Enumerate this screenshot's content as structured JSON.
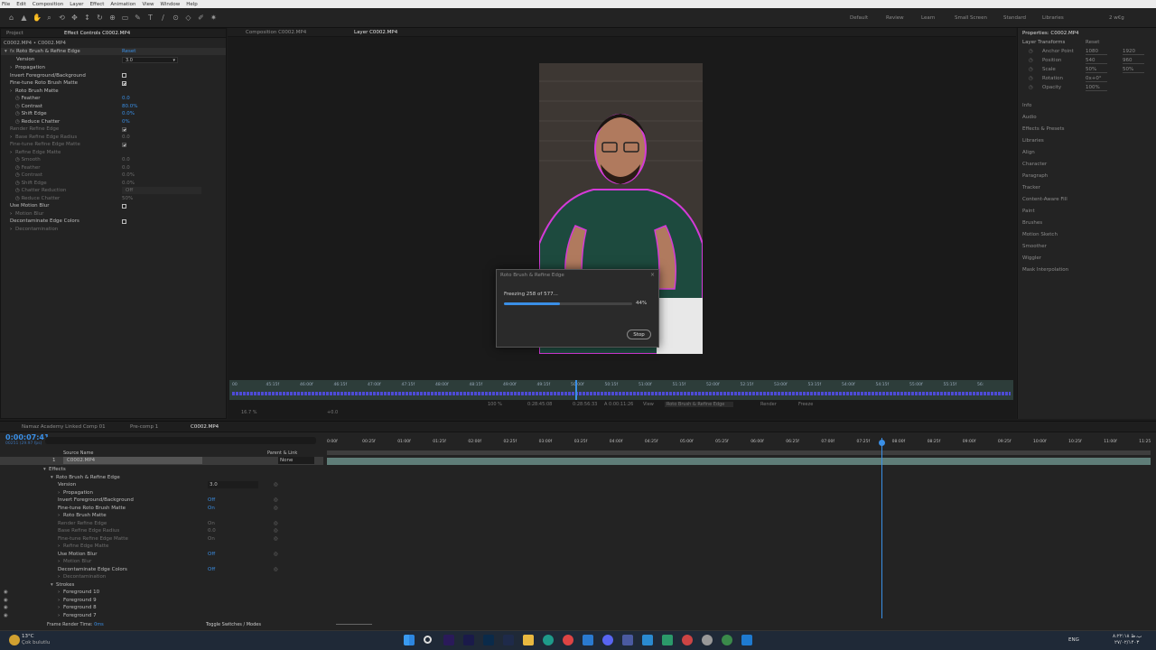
{
  "menu": [
    "File",
    "Edit",
    "Composition",
    "Layer",
    "Effect",
    "Animation",
    "View",
    "Window",
    "Help"
  ],
  "workspaces": [
    "Default",
    "Review",
    "Learn",
    "Small Screen",
    "Standard",
    "Libraries"
  ],
  "workspace_right": "2 w€g",
  "effect_controls": {
    "tabs": [
      "Project",
      "Effect Controls C0002.MP4"
    ],
    "header": "C0002.MP4 • C0002.MP4",
    "effect_name": "Roto Brush & Refine Edge",
    "reset": "Reset",
    "version_label": "Version",
    "version_value": "3.0",
    "rows": [
      {
        "label": "Propagation",
        "indent": 1,
        "twirl": true,
        "dim": false
      },
      {
        "label": "Invert Foreground/Background",
        "indent": 1,
        "dim": false,
        "checkbox": "off"
      },
      {
        "label": "Fine-tune Roto Brush Matte",
        "indent": 1,
        "dim": false,
        "checkbox": "on"
      },
      {
        "label": "Roto Brush Matte",
        "indent": 1,
        "twirl": true,
        "dim": false
      },
      {
        "label": "Feather",
        "indent": 2,
        "dim": false,
        "value": "0.0",
        "blue": true
      },
      {
        "label": "Contrast",
        "indent": 2,
        "dim": false,
        "value": "80.0%",
        "blue": true
      },
      {
        "label": "Shift Edge",
        "indent": 2,
        "dim": false,
        "value": "0.0%",
        "blue": true
      },
      {
        "label": "Reduce Chatter",
        "indent": 2,
        "dim": false,
        "value": "0%",
        "blue": true
      },
      {
        "label": "Render Refine Edge",
        "indent": 1,
        "dim": true,
        "checkbox": "on"
      },
      {
        "label": "Base Refine Edge Radius",
        "indent": 1,
        "twirl": true,
        "dim": true,
        "value": "0.0"
      },
      {
        "label": "Fine-tune Refine Edge Matte",
        "indent": 1,
        "dim": true,
        "checkbox": "on"
      },
      {
        "label": "Refine Edge Matte",
        "indent": 1,
        "twirl": true,
        "dim": true
      },
      {
        "label": "Smooth",
        "indent": 2,
        "dim": true,
        "value": "0.0"
      },
      {
        "label": "Feather",
        "indent": 2,
        "dim": true,
        "value": "0.0"
      },
      {
        "label": "Contrast",
        "indent": 2,
        "dim": true,
        "value": "0.0%"
      },
      {
        "label": "Shift Edge",
        "indent": 2,
        "dim": true,
        "value": "0.0%"
      },
      {
        "label": "Chatter Reduction",
        "indent": 2,
        "dim": true,
        "value": "Off"
      },
      {
        "label": "Reduce Chatter",
        "indent": 2,
        "dim": true,
        "value": "50%"
      },
      {
        "label": "Use Motion Blur",
        "indent": 1,
        "dim": false,
        "checkbox": "off"
      },
      {
        "label": "Motion Blur",
        "indent": 1,
        "twirl": true,
        "dim": true
      },
      {
        "label": "Decontaminate Edge Colors",
        "indent": 1,
        "dim": false,
        "checkbox": "off"
      },
      {
        "label": "Decontamination",
        "indent": 1,
        "twirl": true,
        "dim": true
      }
    ]
  },
  "viewer": {
    "tabs": [
      "Composition C0002.MP4",
      "Layer C0002.MP4"
    ],
    "mini_ticks": [
      "00",
      "45:15f",
      "46:00f",
      "46:15f",
      "47:00f",
      "47:15f",
      "48:00f",
      "48:15f",
      "49:00f",
      "49:15f",
      "50:00f",
      "50:15f",
      "51:00f",
      "51:15f",
      "52:00f",
      "52:15f",
      "53:00f",
      "53:15f",
      "54:00f",
      "54:15f",
      "55:00f",
      "55:15f",
      "56:"
    ],
    "bottom_bar": [
      "16.7 %",
      "+0.0",
      "0:28:45:08",
      "0:28:56:33",
      "A 0:00:11:26",
      "View",
      "Roto Brush & Refine Edge",
      "Render",
      "Freeze",
      "100 %"
    ]
  },
  "dialog": {
    "title": "Roto Brush & Refine Edge",
    "status": "Freezing 258 of 577...",
    "progress": 0.44,
    "percent_label": "44%",
    "stop_label": "Stop"
  },
  "properties": {
    "title": "Properties: C0002.MP4",
    "layer_transforms": "Layer Transforms",
    "reset": "Reset",
    "rows": [
      {
        "label": "Anchor Point",
        "v1": "1080",
        "v2": "1920"
      },
      {
        "label": "Position",
        "v1": "540",
        "v2": "960"
      },
      {
        "label": "Scale",
        "v1": "50%",
        "v2": "50%"
      },
      {
        "label": "Rotation",
        "v1": "0x+0°",
        "v2": ""
      },
      {
        "label": "Opacity",
        "v1": "100%",
        "v2": ""
      }
    ],
    "panels": [
      "Info",
      "Audio",
      "Effects & Presets",
      "Libraries",
      "Align",
      "Character",
      "Paragraph",
      "Tracker",
      "Content-Aware Fill",
      "Paint",
      "Brushes",
      "Motion Sketch",
      "Smoother",
      "Wiggler",
      "Mask Interpolation"
    ]
  },
  "timeline": {
    "tabs": [
      "Namaz Academy Linked Comp 01",
      "Pre-comp 1",
      "C0002.MP4"
    ],
    "timecode": "0:00:07:41",
    "timecode_sub": "00251 (29.97 fps)",
    "col_source": "Source Name",
    "col_parent": "Parent & Link",
    "layer_num": "1",
    "layer_name": "C0002.MP4",
    "parent_value": "None",
    "ruler": [
      "0:00f",
      "00:25f",
      "01:00f",
      "01:25f",
      "02:00f",
      "02:25f",
      "03:00f",
      "03:25f",
      "04:00f",
      "04:25f",
      "05:00f",
      "05:25f",
      "06:00f",
      "06:25f",
      "07:00f",
      "07:25f",
      "08:00f",
      "08:25f",
      "09:00f",
      "09:25f",
      "10:00f",
      "10:25f",
      "11:00f",
      "11:25"
    ],
    "rows": [
      {
        "label": "Effects",
        "indent": 1,
        "value": ""
      },
      {
        "label": "Roto Brush & Refine Edge",
        "indent": 2,
        "value": ""
      },
      {
        "label": "Version",
        "indent": 3,
        "value": "3.0",
        "dropdown": true
      },
      {
        "label": "Propagation",
        "indent": 3,
        "value": "",
        "twirl": true
      },
      {
        "label": "Invert Foreground/Background",
        "indent": 3,
        "value": "Off",
        "blue": true
      },
      {
        "label": "Fine-tune Roto Brush Matte",
        "indent": 3,
        "value": "On",
        "blue": true
      },
      {
        "label": "Roto Brush Matte",
        "indent": 3,
        "value": "",
        "twirl": true
      },
      {
        "label": "Render Refine Edge",
        "indent": 3,
        "value": "On",
        "dim": true
      },
      {
        "label": "Base Refine Edge Radius",
        "indent": 3,
        "value": "0.0",
        "dim": true
      },
      {
        "label": "Fine-tune Refine Edge Matte",
        "indent": 3,
        "value": "On",
        "dim": true
      },
      {
        "label": "Refine Edge Matte",
        "indent": 3,
        "value": "",
        "twirl": true,
        "dim": true
      },
      {
        "label": "Use Motion Blur",
        "indent": 3,
        "value": "Off",
        "blue": true
      },
      {
        "label": "Motion Blur",
        "indent": 3,
        "value": "",
        "twirl": true,
        "dim": true
      },
      {
        "label": "Decontaminate Edge Colors",
        "indent": 3,
        "value": "Off",
        "blue": true
      },
      {
        "label": "Decontamination",
        "indent": 3,
        "value": "",
        "twirl": true,
        "dim": true
      },
      {
        "label": "Strokes",
        "indent": 2,
        "value": ""
      },
      {
        "label": "Foreground 10",
        "indent": 3,
        "value": "",
        "twirl": true
      },
      {
        "label": "Foreground 9",
        "indent": 3,
        "value": "",
        "twirl": true
      },
      {
        "label": "Foreground 8",
        "indent": 3,
        "value": "",
        "twirl": true
      },
      {
        "label": "Foreground 7",
        "indent": 3,
        "value": "",
        "twirl": true
      }
    ],
    "footer_left": "Frame Render Time:",
    "footer_time": "0ms",
    "footer_mid": "Toggle Switches / Modes"
  },
  "taskbar": {
    "weather_temp": "13°C",
    "weather_desc": "Çok bulutlu",
    "lang": "ENG",
    "time": "۸:۲۲:۱۸ ب.ظ",
    "date": "۲۷/۰۲/۱۴۰۳"
  },
  "colors": {
    "accent": "#3a8fe6",
    "panel": "#232323",
    "timeline_bar": "#5f7d78"
  }
}
